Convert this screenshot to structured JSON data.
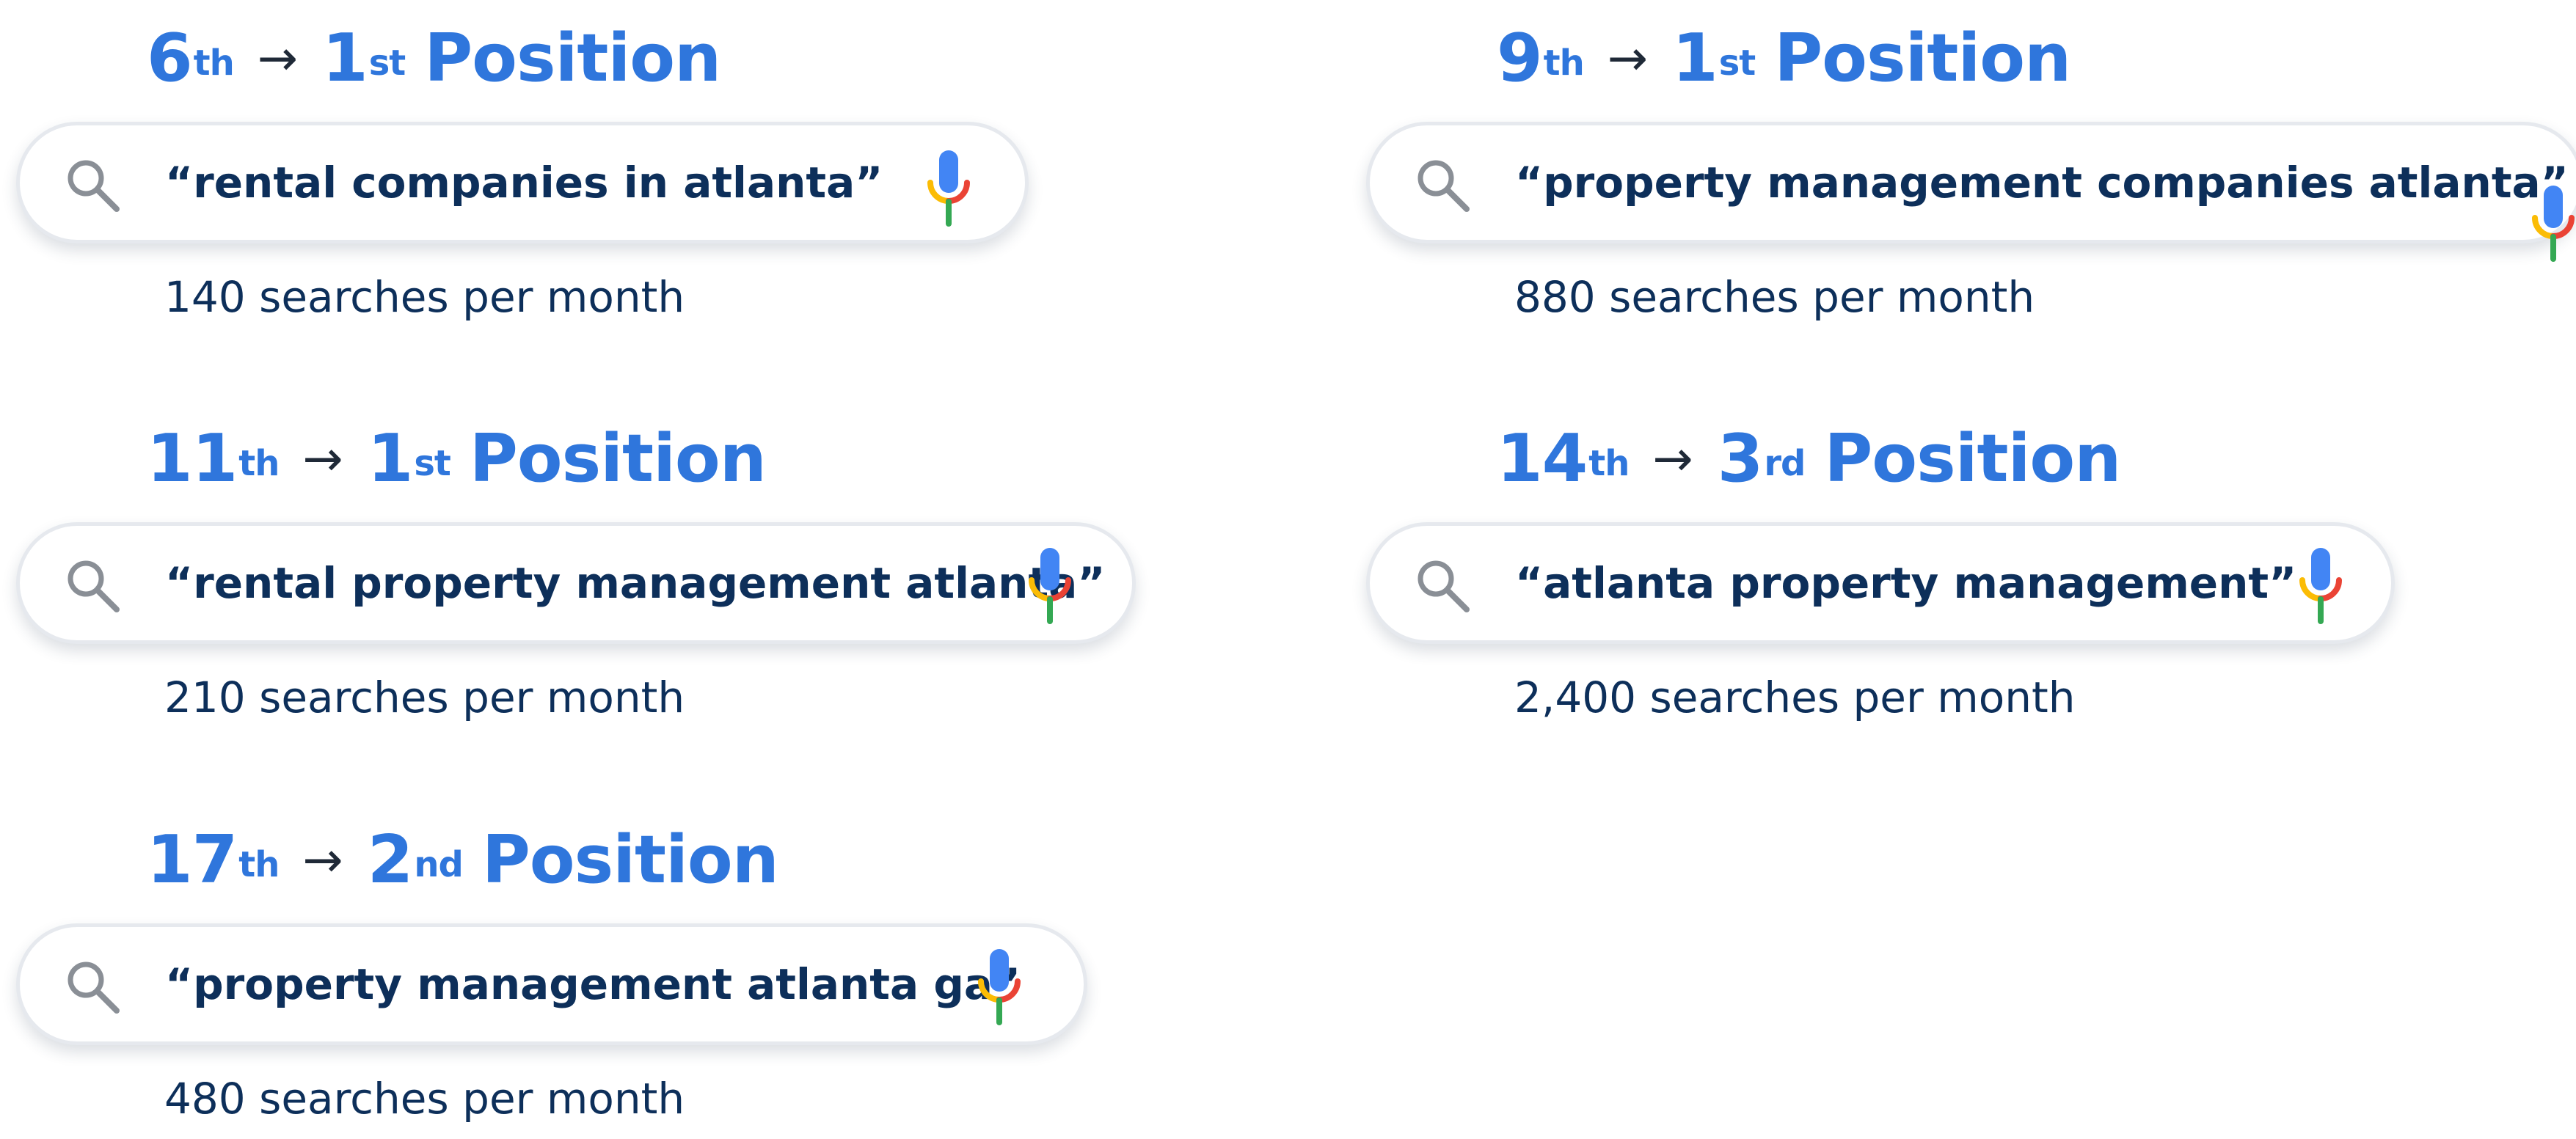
{
  "colors": {
    "heading_blue": "#2f76dc",
    "query_navy": "#0d2f5a",
    "mic_blue": "#4285f4",
    "mic_red": "#ea4335",
    "mic_yellow": "#fbbc05",
    "mic_green": "#34a853"
  },
  "icons": {
    "search": "search-icon",
    "mic": "microphone-icon",
    "arrow": "arrow-right-icon"
  },
  "results": [
    {
      "from_rank": "6",
      "from_suffix": "th",
      "arrow": "→",
      "to_rank": "1",
      "to_suffix": "st",
      "position_label": "Position",
      "query": "“rental companies in atlanta”",
      "volume": "140 searches per month"
    },
    {
      "from_rank": "9",
      "from_suffix": "th",
      "arrow": "→",
      "to_rank": "1",
      "to_suffix": "st",
      "position_label": "Position",
      "query": "“property management companies atlanta”",
      "volume": "880 searches per month"
    },
    {
      "from_rank": "11",
      "from_suffix": "th",
      "arrow": "→",
      "to_rank": "1",
      "to_suffix": "st",
      "position_label": "Position",
      "query": "“rental property management atlanta”",
      "volume": "210 searches per month"
    },
    {
      "from_rank": "14",
      "from_suffix": "th",
      "arrow": "→",
      "to_rank": "3",
      "to_suffix": "rd",
      "position_label": "Position",
      "query": "“atlanta property management”",
      "volume": "2,400 searches per month"
    },
    {
      "from_rank": "17",
      "from_suffix": "th",
      "arrow": "→",
      "to_rank": "2",
      "to_suffix": "nd",
      "position_label": "Position",
      "query": "“property management atlanta ga”",
      "volume": "480 searches per month"
    }
  ]
}
